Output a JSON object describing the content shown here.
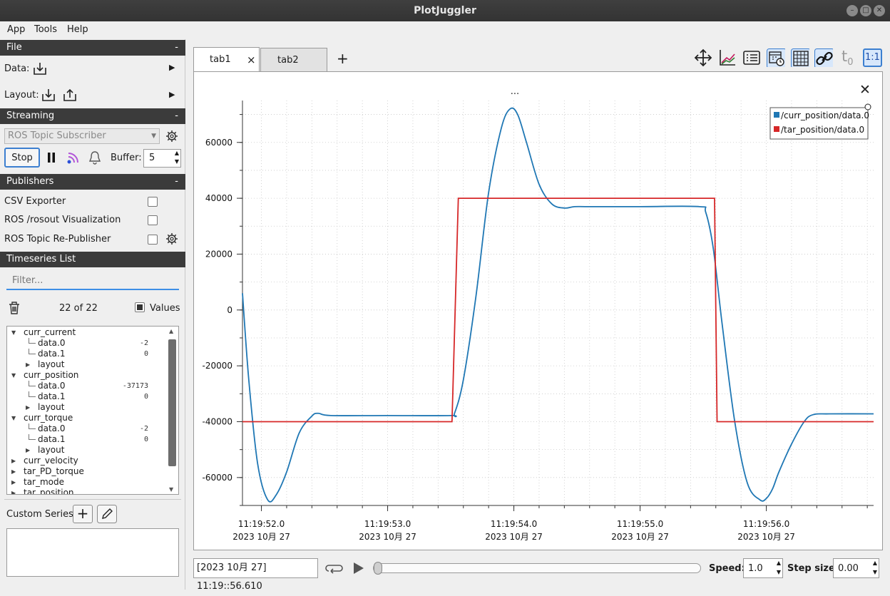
{
  "window": {
    "title": "PlotJuggler"
  },
  "menu": [
    "App",
    "Tools",
    "Help"
  ],
  "file": {
    "header": "File",
    "collapse": "-",
    "data_label": "Data:",
    "layout_label": "Layout:"
  },
  "streaming": {
    "header": "Streaming",
    "collapse": "-",
    "source": "ROS Topic Subscriber",
    "stop_label": "Stop",
    "buffer_label": "Buffer:",
    "buffer_value": "5"
  },
  "publishers": {
    "header": "Publishers",
    "collapse": "-",
    "items": [
      "CSV Exporter",
      "ROS /rosout Visualization",
      "ROS Topic Re-Publisher"
    ]
  },
  "timeseries": {
    "header": "Timeseries List",
    "filter_placeholder": "Filter...",
    "count": "22 of 22",
    "values_label": "Values",
    "tree": [
      {
        "level": 0,
        "name": "curr_current",
        "expanded": true,
        "value": ""
      },
      {
        "level": 1,
        "name": "data.0",
        "value": "-2"
      },
      {
        "level": 1,
        "name": "data.1",
        "value": "0"
      },
      {
        "level": 1,
        "name": "layout",
        "collapsed": true,
        "value": ""
      },
      {
        "level": 0,
        "name": "curr_position",
        "expanded": true,
        "value": ""
      },
      {
        "level": 1,
        "name": "data.0",
        "value": "-37173"
      },
      {
        "level": 1,
        "name": "data.1",
        "value": "0"
      },
      {
        "level": 1,
        "name": "layout",
        "collapsed": true,
        "value": ""
      },
      {
        "level": 0,
        "name": "curr_torque",
        "expanded": true,
        "value": ""
      },
      {
        "level": 1,
        "name": "data.0",
        "value": "-2"
      },
      {
        "level": 1,
        "name": "data.1",
        "value": "0"
      },
      {
        "level": 1,
        "name": "layout",
        "collapsed": true,
        "value": ""
      },
      {
        "level": 0,
        "name": "curr_velocity",
        "collapsed": true,
        "value": ""
      },
      {
        "level": 0,
        "name": "tar_PD_torque",
        "collapsed": true,
        "value": ""
      },
      {
        "level": 0,
        "name": "tar_mode",
        "collapsed": true,
        "value": ""
      },
      {
        "level": 0,
        "name": "tar_position",
        "collapsed": true,
        "value": ""
      }
    ],
    "custom_series_label": "Custom Series:"
  },
  "tabs": {
    "items": [
      "tab1",
      "tab2"
    ],
    "close": "×",
    "add": "+"
  },
  "plot": {
    "title": "...",
    "close": "✕"
  },
  "toolbar": {
    "t0_label": "t",
    "t0_sub": "0",
    "ratio_label": "1:1"
  },
  "bottom": {
    "timestamp": "[2023 10月 27] 11:19::56.610",
    "speed_label": "Speed:",
    "speed_value": "1.0",
    "step_label": "Step size:",
    "step_value": "0.00",
    "slider_position": 0.0
  },
  "chart_data": {
    "type": "line",
    "x_tick_times": [
      "11:19:52.0",
      "11:19:53.0",
      "11:19:54.0",
      "11:19:55.0",
      "11:19:56.0"
    ],
    "x_tick_dates": [
      "2023 10月 27",
      "2023 10月 27",
      "2023 10月 27",
      "2023 10月 27",
      "2023 10月 27"
    ],
    "x_tick_seconds": [
      52.0,
      53.0,
      54.0,
      55.0,
      56.0
    ],
    "xlim": [
      51.85,
      56.85
    ],
    "y_ticks": [
      60000,
      40000,
      20000,
      0,
      -20000,
      -40000,
      -60000
    ],
    "ylim": [
      -70000,
      75000
    ],
    "grid": true,
    "legend_position": "top-right",
    "series": [
      {
        "name": "/curr_position/data.0",
        "color": "#1f77b4",
        "x": [
          51.85,
          51.9,
          51.97,
          52.05,
          52.12,
          52.2,
          52.3,
          52.4,
          52.45,
          52.55,
          53.0,
          53.5,
          53.53,
          53.6,
          53.7,
          53.8,
          53.9,
          53.97,
          54.03,
          54.1,
          54.2,
          54.3,
          54.4,
          54.48,
          54.6,
          55.0,
          55.47,
          55.52,
          55.58,
          55.65,
          55.75,
          55.85,
          55.95,
          56.0,
          56.05,
          56.1,
          56.2,
          56.3,
          56.37,
          56.5,
          56.85
        ],
        "y": [
          6000,
          -25000,
          -55000,
          -68000,
          -66000,
          -58000,
          -44000,
          -38000,
          -37000,
          -37800,
          -37800,
          -37800,
          -37000,
          -25000,
          5000,
          42000,
          65000,
          72000,
          70000,
          60000,
          45000,
          38000,
          36500,
          37000,
          37000,
          37000,
          37000,
          35000,
          22000,
          -5000,
          -40000,
          -62000,
          -68000,
          -67500,
          -64000,
          -58000,
          -48000,
          -40000,
          -37500,
          -37200,
          -37200
        ]
      },
      {
        "name": "/tar_position/data.0",
        "color": "#d62728",
        "x": [
          51.85,
          53.5,
          53.51,
          53.56,
          55.58,
          55.59,
          55.61,
          56.85
        ],
        "y": [
          -40000,
          -40000,
          -40000,
          40000,
          40000,
          40000,
          -40000,
          -40000
        ]
      }
    ]
  }
}
